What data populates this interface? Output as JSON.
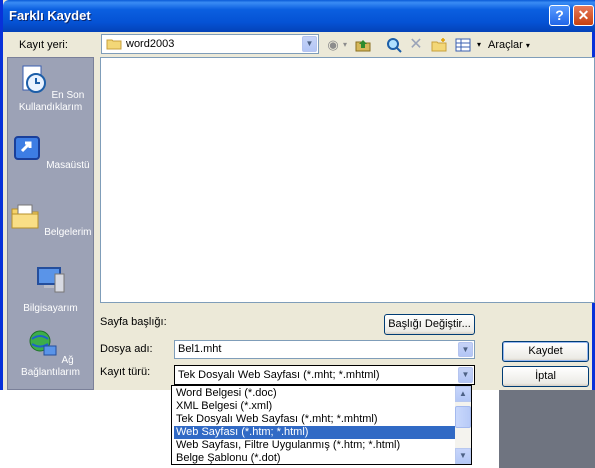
{
  "title": "Farklı Kaydet",
  "window_buttons": {
    "help": "?",
    "close": "✕"
  },
  "save_in": {
    "label": "Kayıt yeri:",
    "value": "word2003"
  },
  "toolbar": {
    "tools_label": "Araçlar"
  },
  "places": [
    {
      "label": "En Son Kullandıklarım",
      "icon": "recent-icon"
    },
    {
      "label": "Masaüstü",
      "icon": "desktop-icon"
    },
    {
      "label": "Belgelerim",
      "icon": "my-documents-icon"
    },
    {
      "label": "Bilgisayarım",
      "icon": "my-computer-icon"
    },
    {
      "label": "Ağ Bağlantılarım",
      "icon": "network-icon"
    }
  ],
  "page_title": {
    "label": "Sayfa başlığı:",
    "button": "Başlığı Değiştir..."
  },
  "file_name": {
    "label": "Dosya adı:",
    "value": "Bel1.mht"
  },
  "file_type": {
    "label": "Kayıt türü:",
    "value": "Tek Dosyalı Web Sayfası (*.mht; *.mhtml)",
    "options": [
      "Word Belgesi (*.doc)",
      "XML Belgesi (*.xml)",
      "Tek Dosyalı Web Sayfası (*.mht; *.mhtml)",
      "Web Sayfası (*.htm; *.html)",
      "Web Sayfası, Filtre Uygulanmış (*.htm; *.html)",
      "Belge Şablonu (*.dot)"
    ],
    "selected_index": 3
  },
  "buttons": {
    "save": "Kaydet",
    "cancel": "İptal"
  }
}
